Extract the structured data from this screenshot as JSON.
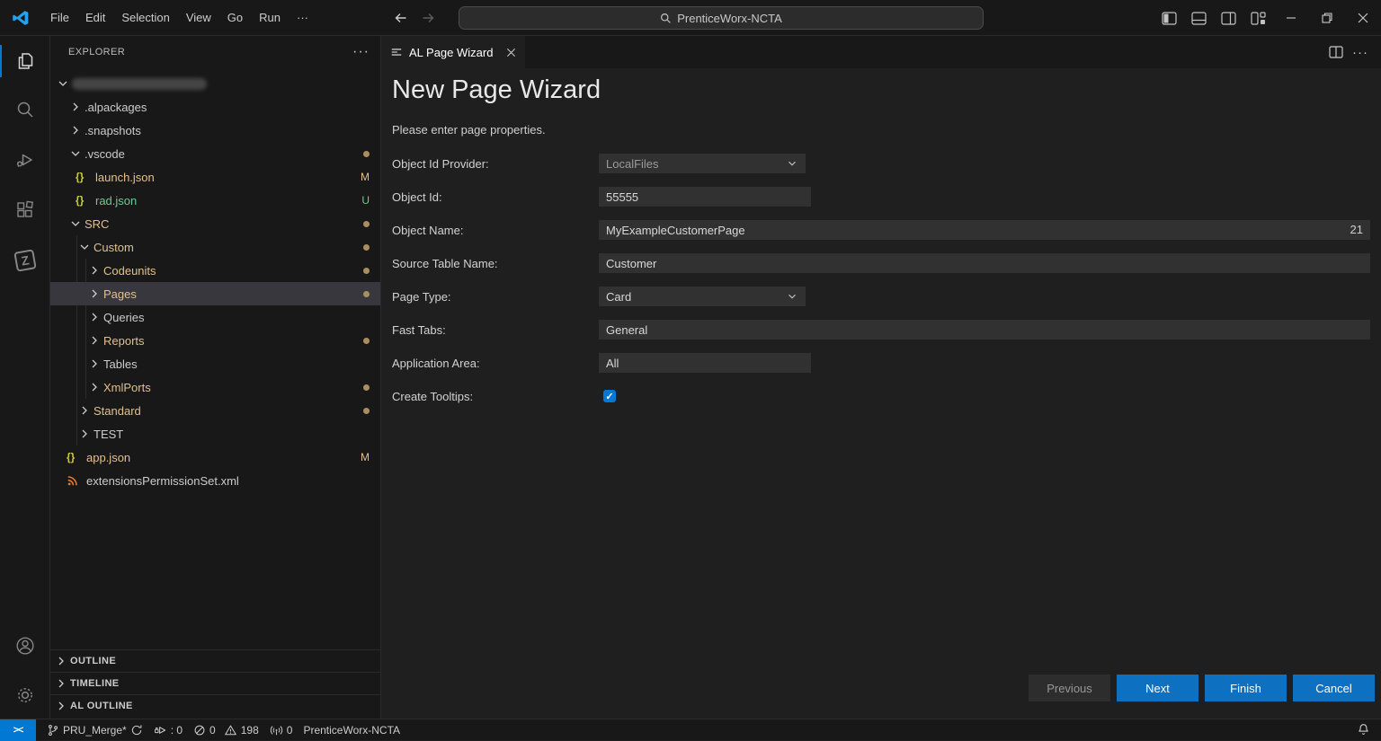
{
  "colors": {
    "accent": "#0078d4",
    "button": "#0e70c0",
    "git_modified": "#e2c08d",
    "git_untracked": "#73c991",
    "dot": "#a98f5f"
  },
  "title_bar": {
    "menus": [
      "File",
      "Edit",
      "Selection",
      "View",
      "Go",
      "Run",
      "···"
    ],
    "search_value": "PrenticeWorx-NCTA"
  },
  "explorer": {
    "title": "EXPLORER",
    "more": "···",
    "items": [
      {
        "label": ""
      },
      {
        "label": ".alpackages"
      },
      {
        "label": ".snapshots"
      },
      {
        "label": ".vscode"
      },
      {
        "label": "launch.json",
        "badge": "M"
      },
      {
        "label": "rad.json",
        "badge": "U"
      },
      {
        "label": "SRC"
      },
      {
        "label": "Custom"
      },
      {
        "label": "Codeunits"
      },
      {
        "label": "Pages"
      },
      {
        "label": "Queries"
      },
      {
        "label": "Reports"
      },
      {
        "label": "Tables"
      },
      {
        "label": "XmlPorts"
      },
      {
        "label": "Standard"
      },
      {
        "label": "TEST"
      },
      {
        "label": "app.json",
        "badge": "M"
      },
      {
        "label": "extensionsPermissionSet.xml"
      }
    ],
    "sections": [
      {
        "label": "OUTLINE"
      },
      {
        "label": "TIMELINE"
      },
      {
        "label": "AL OUTLINE"
      }
    ]
  },
  "editor": {
    "tab_title": "AL Page Wizard",
    "more": "···",
    "page_title": "New Page Wizard",
    "subtitle": "Please enter page properties.",
    "fields": {
      "provider": {
        "label": "Object Id Provider:",
        "value": "LocalFiles"
      },
      "object_id": {
        "label": "Object Id:",
        "value": "55555"
      },
      "object_name": {
        "label": "Object Name:",
        "value": "MyExampleCustomerPage",
        "counter": "21"
      },
      "source_table": {
        "label": "Source Table Name:",
        "value": "Customer"
      },
      "page_type": {
        "label": "Page Type:",
        "value": "Card"
      },
      "fast_tabs": {
        "label": "Fast Tabs:",
        "value": "General"
      },
      "application_area": {
        "label": "Application Area:",
        "value": "All"
      },
      "create_tooltips": {
        "label": "Create Tooltips:",
        "checked": true
      }
    },
    "buttons": {
      "previous": "Previous",
      "next": "Next",
      "finish": "Finish",
      "cancel": "Cancel"
    }
  },
  "status_bar": {
    "remote_indicator": "><",
    "branch": "PRU_Merge*",
    "rad": ": 0",
    "errors": "0",
    "warnings": "198",
    "broadcast": "0",
    "workspace": "PrenticeWorx-NCTA"
  }
}
